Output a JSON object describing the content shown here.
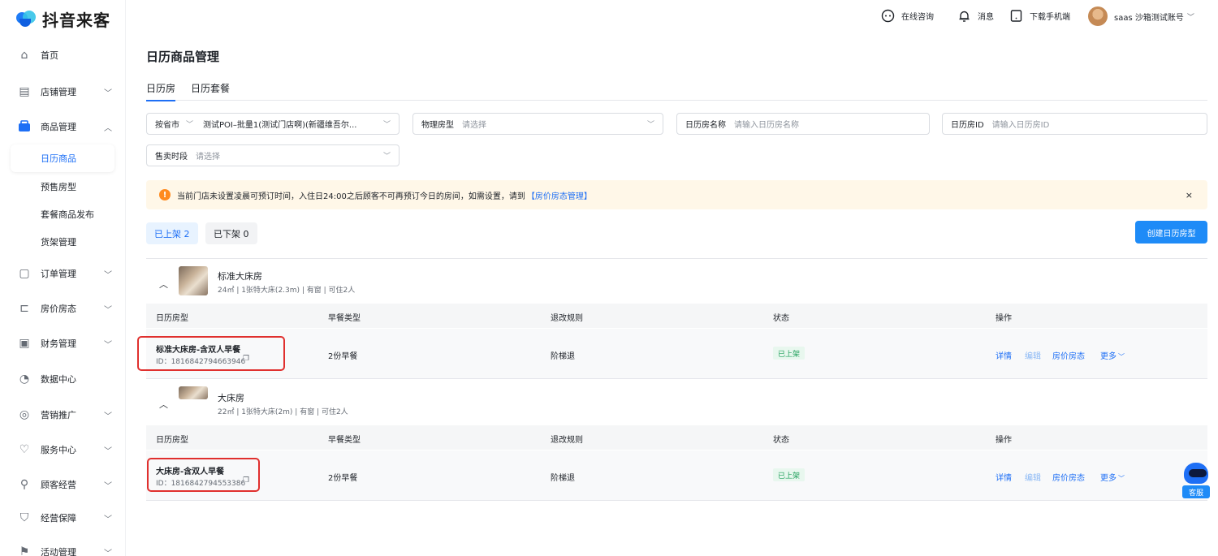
{
  "app": {
    "name": "抖音来客"
  },
  "sidebar": {
    "items": [
      {
        "label": "首页",
        "icon": "home-icon"
      },
      {
        "label": "店铺管理",
        "icon": "store-icon"
      },
      {
        "label": "商品管理",
        "icon": "goods-icon"
      },
      {
        "label": "订单管理",
        "icon": "order-icon"
      },
      {
        "label": "房价房态",
        "icon": "bed-icon"
      },
      {
        "label": "财务管理",
        "icon": "finance-icon"
      },
      {
        "label": "数据中心",
        "icon": "chart-icon"
      },
      {
        "label": "营销推广",
        "icon": "marketing-icon"
      },
      {
        "label": "服务中心",
        "icon": "heart-icon"
      },
      {
        "label": "顾客经营",
        "icon": "user-icon"
      },
      {
        "label": "经营保障",
        "icon": "shield-icon"
      },
      {
        "label": "活动管理",
        "icon": "flag-icon"
      }
    ],
    "subitems": [
      {
        "label": "日历商品"
      },
      {
        "label": "预售房型"
      },
      {
        "label": "套餐商品发布"
      },
      {
        "label": "货架管理"
      }
    ]
  },
  "header": {
    "consult": "在线咨询",
    "messages": "消息",
    "download": "下载手机端",
    "account": "saas 沙箱测试账号"
  },
  "page": {
    "title": "日历商品管理",
    "tabs": [
      {
        "label": "日历房"
      },
      {
        "label": "日历套餐"
      }
    ]
  },
  "filters": {
    "region": {
      "label": "按省市",
      "value": "测试POI–批量1(测试门店啊)(新疆维吾尔..."
    },
    "room_type": {
      "label": "物理房型",
      "placeholder": "请选择"
    },
    "room_name": {
      "label": "日历房名称",
      "placeholder": "请输入日历房名称"
    },
    "room_id": {
      "label": "日历房ID",
      "placeholder": "请输入日历房ID"
    },
    "period": {
      "label": "售卖时段",
      "placeholder": "请选择"
    }
  },
  "notice": {
    "text": "当前门店未设置凌晨可预订时间，入住日24:00之后顾客不可再预订今日的房间，如需设置，请到",
    "link": "【房价房态管理】",
    "close": "×"
  },
  "status_tabs": {
    "on": "已上架 2",
    "off": "已下架 0"
  },
  "create_button": "创建日历房型",
  "table": {
    "headers": [
      "日历房型",
      "早餐类型",
      "退改规则",
      "状态",
      "操作"
    ]
  },
  "groups": [
    {
      "name": "标准大床房",
      "meta": "24㎡ | 1张特大床(2.3m) | 有窗 | 可住2人",
      "rows": [
        {
          "name": "标准大床房-含双人早餐",
          "id": "ID：1816842794663946",
          "breakfast": "2份早餐",
          "refund": "阶梯退",
          "status": "已上架"
        }
      ]
    },
    {
      "name": "大床房",
      "meta": "22㎡ | 1张特大床(2m) | 有窗 | 可住2人",
      "rows": [
        {
          "name": "大床房-含双人早餐",
          "id": "ID：1816842794553386",
          "breakfast": "2份早餐",
          "refund": "阶梯退",
          "status": "已上架"
        }
      ]
    }
  ],
  "operations": {
    "detail": "详情",
    "edit": "编辑",
    "price": "房价房态",
    "more": "更多"
  },
  "assistant": {
    "label": "客服"
  },
  "colors": {
    "accent": "#1e6ff5",
    "button": "#1e8bf7",
    "highlight": "#e0302e",
    "success": "#23a15d",
    "warning_bg": "#fff7e8"
  }
}
